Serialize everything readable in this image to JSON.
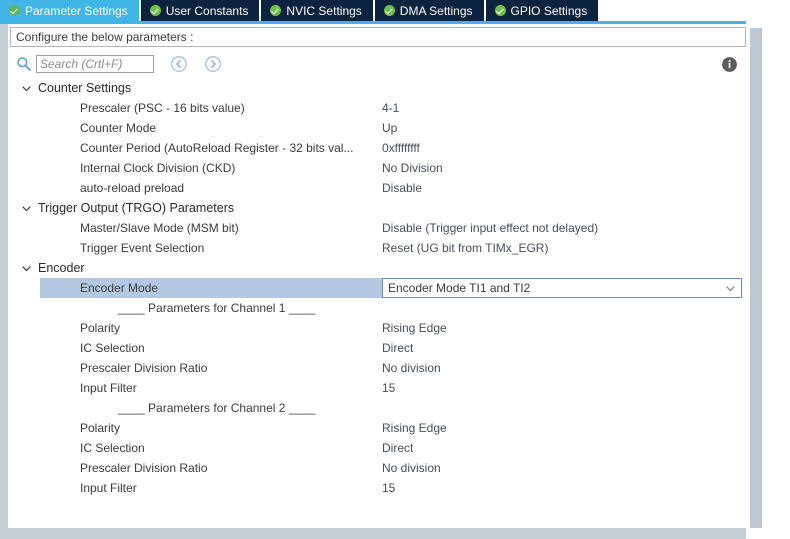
{
  "colors": {
    "active_tab_bg": "#41b6e6",
    "inactive_tab_bg": "#0c2340",
    "tab_check": "#6fbf4a",
    "underline": "#41b6e6",
    "selection_highlight": "#b3c9e3",
    "combo_border": "#6c8cbb",
    "rail": "#c3ced6",
    "scrollbar_thumb": "#bcc8d2"
  },
  "tabs": [
    {
      "label": "Parameter Settings",
      "active": true,
      "icon": "check-circle-icon"
    },
    {
      "label": "User Constants",
      "active": false,
      "icon": "check-circle-icon"
    },
    {
      "label": "NVIC Settings",
      "active": false,
      "icon": "check-circle-icon"
    },
    {
      "label": "DMA Settings",
      "active": false,
      "icon": "check-circle-icon"
    },
    {
      "label": "GPIO Settings",
      "active": false,
      "icon": "check-circle-icon"
    }
  ],
  "header": {
    "text": "Configure the below parameters :"
  },
  "toolbar": {
    "search_icon": "search-icon",
    "search_value": "",
    "search_placeholder": "Search (Crtl+F)",
    "back_button": "back-circle-icon",
    "forward_button": "forward-circle-icon",
    "info_button": "info-icon"
  },
  "groups": [
    {
      "label": "Counter Settings",
      "expanded": true,
      "chevron": "chevron-down-icon",
      "rows": [
        {
          "type": "param",
          "label": "Prescaler (PSC - 16 bits value)",
          "value": "4-1"
        },
        {
          "type": "param",
          "label": "Counter Mode",
          "value": "Up"
        },
        {
          "type": "param",
          "label": "Counter Period (AutoReload Register - 32 bits val...",
          "value": "0xffffffff"
        },
        {
          "type": "param",
          "label": "Internal Clock Division (CKD)",
          "value": "No Division"
        },
        {
          "type": "param",
          "label": "auto-reload preload",
          "value": "Disable"
        }
      ]
    },
    {
      "label": "Trigger Output (TRGO) Parameters",
      "expanded": true,
      "chevron": "chevron-down-icon",
      "rows": [
        {
          "type": "param",
          "label": "Master/Slave Mode (MSM bit)",
          "value": "Disable (Trigger input effect not delayed)"
        },
        {
          "type": "param",
          "label": "Trigger Event Selection",
          "value": "Reset (UG bit from TIMx_EGR)"
        }
      ]
    },
    {
      "label": "Encoder",
      "expanded": true,
      "chevron": "chevron-down-icon",
      "rows": [
        {
          "type": "combo",
          "label": "Encoder Mode",
          "value": "Encoder Mode TI1 and TI2",
          "selected": true,
          "caret": "chevron-down-icon"
        },
        {
          "type": "separator",
          "label": "____ Parameters for Channel 1 ____"
        },
        {
          "type": "param",
          "label": "Polarity",
          "value": "Rising Edge"
        },
        {
          "type": "param",
          "label": "IC Selection",
          "value": "Direct"
        },
        {
          "type": "param",
          "label": "Prescaler Division Ratio",
          "value": "No division"
        },
        {
          "type": "param",
          "label": "Input Filter",
          "value": "15"
        },
        {
          "type": "separator",
          "label": "____ Parameters for Channel 2 ____"
        },
        {
          "type": "param",
          "label": "Polarity",
          "value": "Rising Edge"
        },
        {
          "type": "param",
          "label": "IC Selection",
          "value": "Direct"
        },
        {
          "type": "param",
          "label": "Prescaler Division Ratio",
          "value": "No division"
        },
        {
          "type": "param",
          "label": "Input Filter",
          "value": "15"
        }
      ]
    }
  ]
}
